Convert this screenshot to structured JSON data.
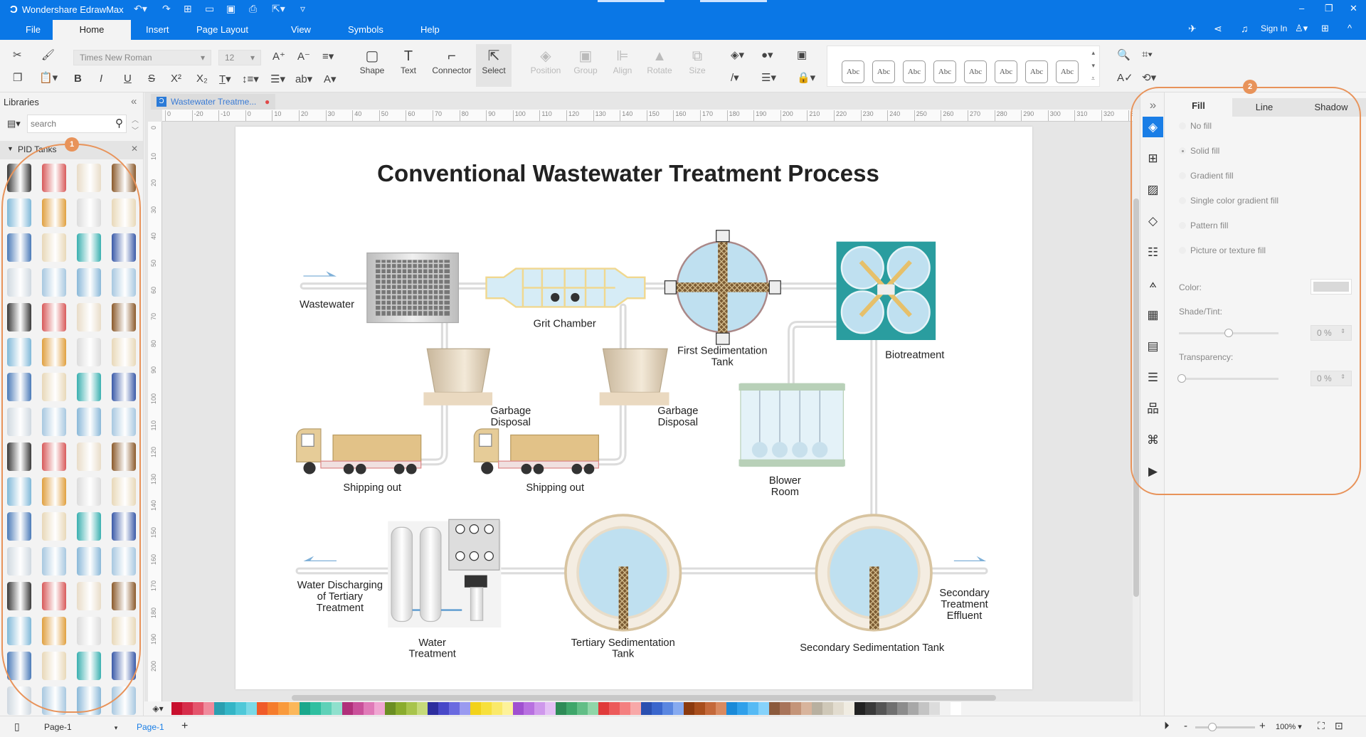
{
  "app": {
    "title": "Wondershare EdrawMax",
    "sign_in": "Sign In"
  },
  "menu": {
    "tabs": [
      "File",
      "Home",
      "Insert",
      "Page Layout",
      "View",
      "Symbols",
      "Help"
    ],
    "active": "Home"
  },
  "toolbar": {
    "font_family": "Times New Roman",
    "font_size": "12",
    "tools": [
      "Shape",
      "Text",
      "Connector",
      "Select"
    ],
    "disabled_tools": [
      "Position",
      "Group",
      "Align",
      "Rotate",
      "Size"
    ],
    "style_swatch_label": "Abc",
    "style_swatch_count": 8
  },
  "libraries": {
    "title": "Libraries",
    "search_placeholder": "search",
    "category": "PID Tanks",
    "badge": "1"
  },
  "document": {
    "tab_title": "Wastewater Treatme...",
    "ruler_h": [
      "0",
      "-20",
      "-10",
      "0",
      "10",
      "20",
      "30",
      "40",
      "50",
      "60",
      "70",
      "80",
      "90",
      "100",
      "110",
      "120",
      "130",
      "140",
      "150",
      "160",
      "170",
      "180",
      "190",
      "200",
      "210",
      "220",
      "230",
      "240",
      "250",
      "260",
      "270",
      "280",
      "290",
      "300",
      "310",
      "320",
      "33"
    ],
    "ruler_v": [
      "0",
      "10",
      "20",
      "30",
      "40",
      "50",
      "60",
      "70",
      "80",
      "90",
      "100",
      "110",
      "120",
      "130",
      "140",
      "150",
      "160",
      "170",
      "180",
      "190",
      "200"
    ]
  },
  "diagram": {
    "title": "Conventional Wastewater Treatment Process",
    "labels": {
      "wastewater": "Wastewater",
      "grit_chamber": "Grit Chamber",
      "first_sed_1": "First Sedimentation",
      "first_sed_2": "Tank",
      "biotreatment": "Biotreatment",
      "garbage1_1": "Garbage",
      "garbage1_2": "Disposal",
      "garbage2_1": "Garbage",
      "garbage2_2": "Disposal",
      "shipping1": "Shipping out",
      "shipping2": "Shipping out",
      "blower_1": "Blower",
      "blower_2": "Room",
      "discharge_1": "Water Discharging",
      "discharge_2": "of Tertiary",
      "discharge_3": "Treatment",
      "water_treat_1": "Water",
      "water_treat_2": "Treatment",
      "tertiary_1": "Tertiary Sedimentation",
      "tertiary_2": "Tank",
      "secondary_tank": "Secondary Sedimentation Tank",
      "effluent_1": "Secondary",
      "effluent_2": "Treatment",
      "effluent_3": "Effluent"
    }
  },
  "format_panel": {
    "badge": "2",
    "tabs": [
      "Fill",
      "Line",
      "Shadow"
    ],
    "active_tab": "Fill",
    "fill_options": [
      "No fill",
      "Solid fill",
      "Gradient fill",
      "Single color gradient fill",
      "Pattern fill",
      "Picture or texture fill"
    ],
    "selected_fill": "Solid fill",
    "color_label": "Color:",
    "color_value": "#d9d9d9",
    "shade_label": "Shade/Tint:",
    "shade_value": "0 %",
    "shade_fraction": 0.5,
    "transparency_label": "Transparency:",
    "transparency_value": "0 %",
    "transparency_fraction": 0
  },
  "palette": [
    "#c8102e",
    "#d62d4a",
    "#e4546c",
    "#f08a9c",
    "#2a9fb0",
    "#34b5c6",
    "#4fc8d8",
    "#7ad9e6",
    "#f05a28",
    "#f57c2c",
    "#f99a3c",
    "#fbb75a",
    "#1aa88c",
    "#2fbfa0",
    "#5fd1b8",
    "#8fe0cd",
    "#b0307a",
    "#c9509a",
    "#e07ab8",
    "#f0a6d2",
    "#6b8e23",
    "#8aac2e",
    "#a8c44c",
    "#c6da7a",
    "#2d2d9e",
    "#4848c8",
    "#6a6ae0",
    "#9a9af0",
    "#f2d21b",
    "#f7e03c",
    "#fae96a",
    "#fdf29a",
    "#a050d0",
    "#b870e0",
    "#cf98ec",
    "#e4c0f5",
    "#2e8b57",
    "#3fa66a",
    "#62be86",
    "#90d6a8",
    "#e03a3a",
    "#ec5a5a",
    "#f48080",
    "#f8a8a8",
    "#2a4fb0",
    "#3a66cc",
    "#5a86e0",
    "#86aaf0",
    "#8b3a0e",
    "#a84e1c",
    "#c4693a",
    "#d98a60",
    "#1a8ad8",
    "#30a0ea",
    "#56baf4",
    "#86d2fa",
    "#8b5a3c",
    "#a8745a",
    "#c49478",
    "#d8b49c",
    "#b8b0a0",
    "#cfc8b8",
    "#e2dccf",
    "#f0ece2",
    "#222222",
    "#3a3a3a",
    "#555555",
    "#707070",
    "#8c8c8c",
    "#a8a8a8",
    "#c4c4c4",
    "#dcdcdc",
    "#f2f2f2",
    "#ffffff"
  ],
  "status": {
    "page_selector": "Page-1",
    "page_tab": "Page-1",
    "zoom": "100%"
  },
  "colors": {
    "brand": "#0a77e6",
    "highlight_ring": "#e8935a",
    "biotreatment": "#2a9d9f"
  }
}
